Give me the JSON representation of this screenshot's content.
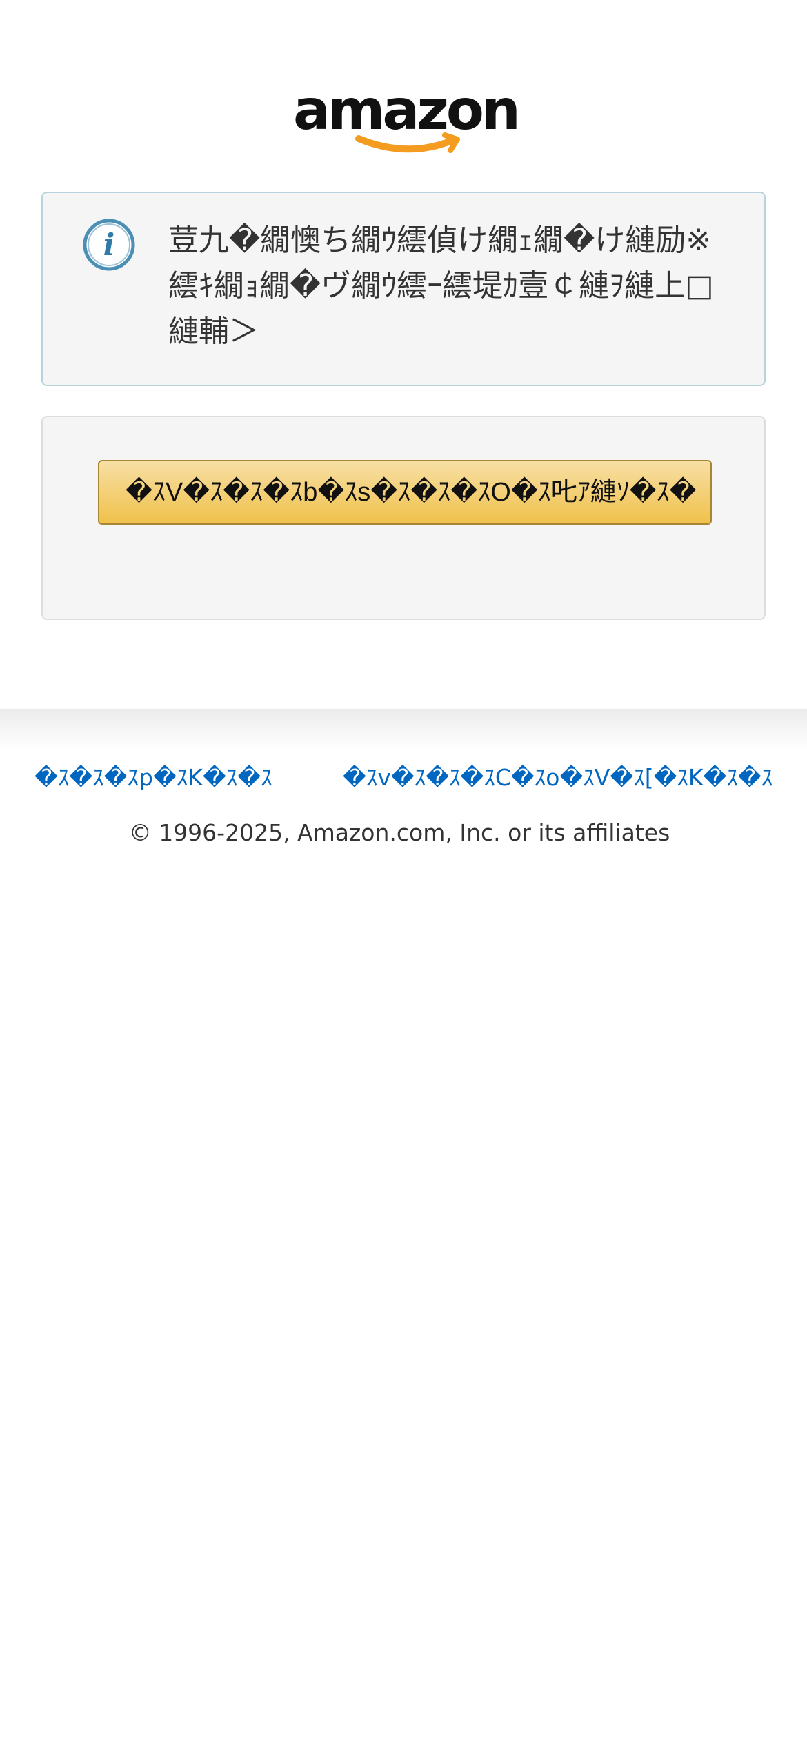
{
  "header": {
    "logo_text": "amazon",
    "logo_icon": "amazon-smile-logo"
  },
  "info_box": {
    "icon": "info-icon",
    "message": "荳九�繝懊ち繝ｳ繧偵け繝ｪ繝�け縺励※繧ｷ繝ｮ繝�ヴ繝ｳ繧ｰ繧堤ｶ壹￠縺ｦ縺上□縺輔＞"
  },
  "actions": {
    "primary_button_label": "�ｽV�ｽ�ｽ�ｽb�ｽs�ｽ�ｽ�ｽO�ｽ𠮟ｱ縺ｿ�ｽ�"
  },
  "footer": {
    "links": [
      "�ｽ�ｽ�ｽp�ｽK�ｽ�ｽ",
      "�ｽv�ｽ�ｽ�ｽC�ｽo�ｽV�ｽ[�ｽK�ｽ�ｽ"
    ],
    "copyright": "© 1996-2025, Amazon.com, Inc. or its affiliates"
  },
  "colors": {
    "link": "#0066c0",
    "button_gradient_top": "#f7dfa5",
    "button_gradient_bottom": "#f0c14b",
    "logo_smile": "#f39c20",
    "info_icon": "#4b8fb5"
  }
}
